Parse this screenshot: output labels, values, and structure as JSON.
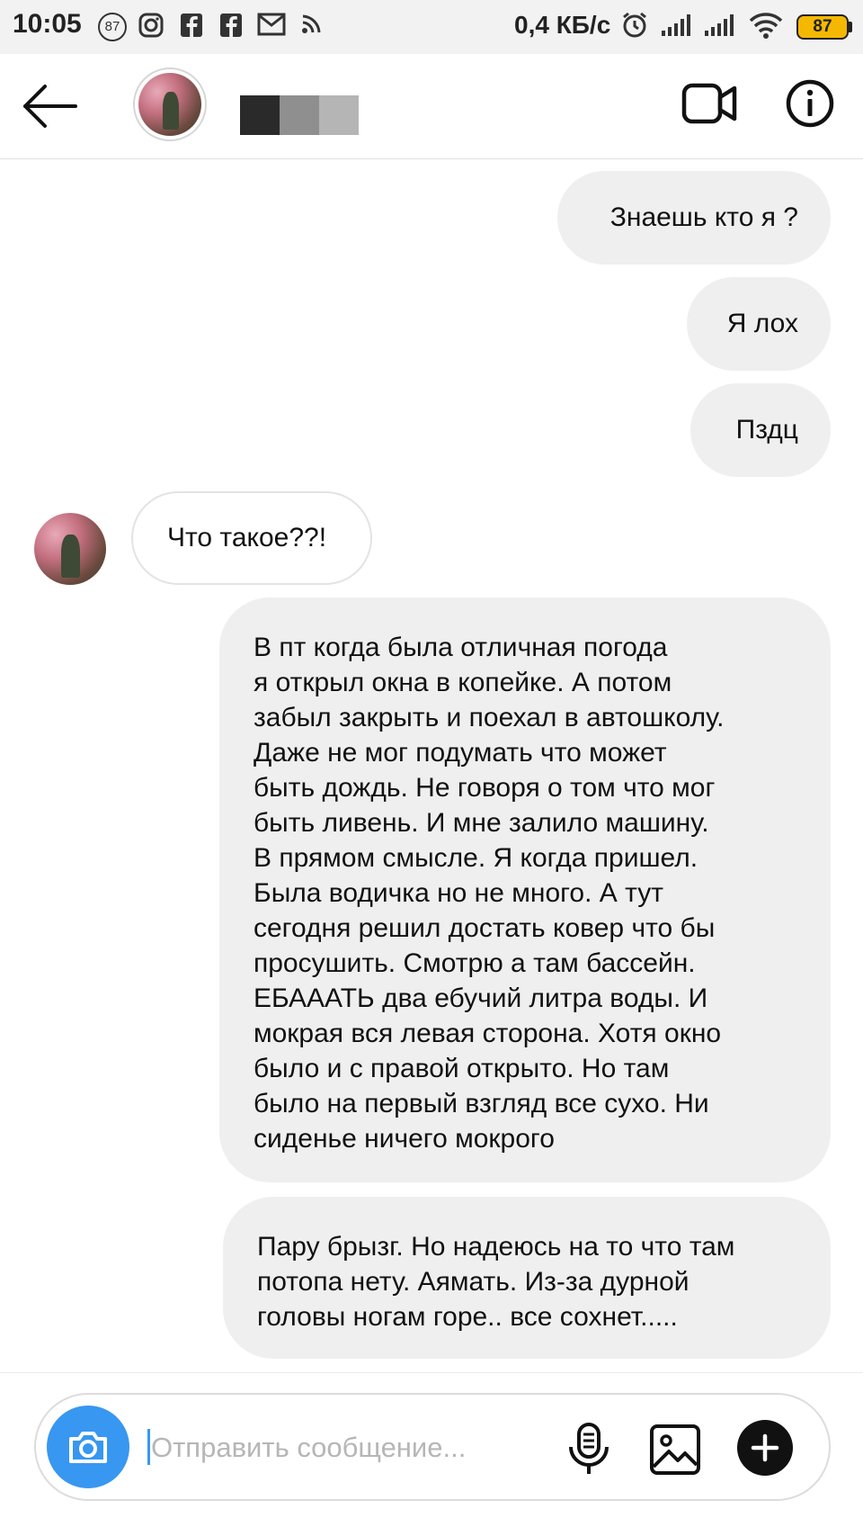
{
  "status_bar": {
    "time": "10:05",
    "notification_count": "87",
    "network_speed": "0,4 КБ/с",
    "battery": "87",
    "battery_color": "#f5b800"
  },
  "header": {
    "back_icon": "arrow-left-icon",
    "contact_name_redacted": true,
    "video_icon": "video-camera-icon",
    "info_icon": "info-icon",
    "redaction_colors": [
      "#2a2a2a",
      "#8f8f8f",
      "#b5b5b5"
    ]
  },
  "messages": [
    {
      "direction": "outgoing",
      "text": "Знаешь кто я ?"
    },
    {
      "direction": "outgoing",
      "text": "Я лох"
    },
    {
      "direction": "outgoing",
      "text": "Пздц"
    },
    {
      "direction": "incoming",
      "text": "Что такое??!"
    },
    {
      "direction": "outgoing",
      "lines": [
        "В пт когда была отличная погода",
        "я открыл окна в копейке. А потом",
        "забыл закрыть и поехал в автошколу.",
        "Даже не мог подумать что может",
        "быть дождь. Не говоря о том что мог",
        "быть ливень. И мне залило машину.",
        "В прямом смысле. Я когда пришел.",
        "Была водичка но не много. А тут",
        "сегодня решил достать ковер что бы",
        "просушить. Смотрю а там бассейн.",
        "ЕБАААТЬ два ебучий литра воды. И",
        "мокрая вся левая сторона. Хотя окно",
        "было и с правой открыто. Но там",
        "было на первый взгляд все сухо. Ни",
        "сиденье ничего мокрого"
      ]
    },
    {
      "direction": "outgoing",
      "lines": [
        "Пару брызг. Но надеюсь на то что там",
        "потопа нету. Аямать. Из-за дурной",
        "головы ногам горе.. все сохнет....."
      ]
    }
  ],
  "composer": {
    "placeholder": "Отправить сообщение...",
    "camera_icon": "camera-icon",
    "mic_icon": "microphone-icon",
    "gallery_icon": "image-icon",
    "plus_icon": "plus-icon",
    "accent_color": "#3897f0"
  }
}
